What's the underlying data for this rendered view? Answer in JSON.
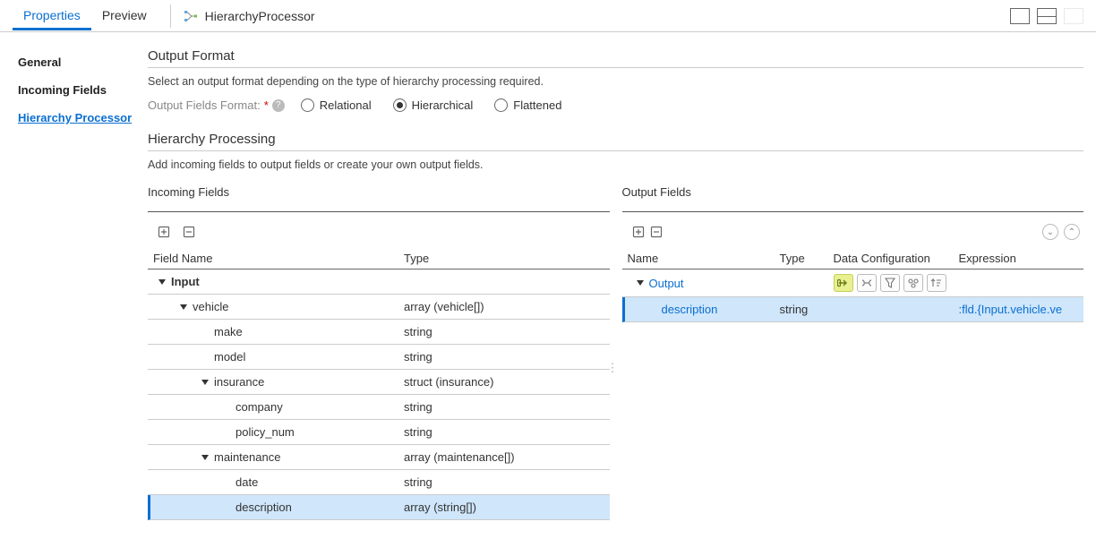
{
  "top": {
    "tabs": [
      "Properties",
      "Preview"
    ],
    "active_tab": 0,
    "processor_name": "HierarchyProcessor"
  },
  "sidebar": {
    "items": [
      "General",
      "Incoming Fields",
      "Hierarchy Processor"
    ],
    "active": 2
  },
  "output_format": {
    "title": "Output Format",
    "desc": "Select an output format depending on the type of hierarchy processing required.",
    "label": "Output Fields Format:",
    "options": [
      "Relational",
      "Hierarchical",
      "Flattened"
    ],
    "selected": 1
  },
  "hierarchy_processing": {
    "title": "Hierarchy Processing",
    "desc": "Add incoming fields to output fields or create your own output fields."
  },
  "incoming": {
    "title": "Incoming Fields",
    "columns": [
      "Field Name",
      "Type"
    ],
    "rows": [
      {
        "indent": 0,
        "caret": true,
        "bold": true,
        "name": "Input",
        "type": ""
      },
      {
        "indent": 1,
        "caret": true,
        "name": "vehicle",
        "type": "array (vehicle[])"
      },
      {
        "indent": 2,
        "caret": false,
        "name": "make",
        "type": "string"
      },
      {
        "indent": 2,
        "caret": false,
        "name": "model",
        "type": "string"
      },
      {
        "indent": 2,
        "caret": true,
        "name": "insurance",
        "type": "struct (insurance)"
      },
      {
        "indent": 3,
        "caret": false,
        "name": "company",
        "type": "string"
      },
      {
        "indent": 3,
        "caret": false,
        "name": "policy_num",
        "type": "string"
      },
      {
        "indent": 2,
        "caret": true,
        "name": "maintenance",
        "type": "array (maintenance[])"
      },
      {
        "indent": 3,
        "caret": false,
        "name": "date",
        "type": "string"
      },
      {
        "indent": 3,
        "caret": false,
        "name": "description",
        "type": "array (string[])",
        "selected": true
      }
    ]
  },
  "output": {
    "title": "Output Fields",
    "columns": [
      "Name",
      "Type",
      "Data Configuration",
      "Expression"
    ],
    "root": {
      "name": "Output"
    },
    "rows": [
      {
        "indent": 1,
        "name": "description",
        "type": "string",
        "expression": ":fld.{Input.vehicle.ve",
        "selected": true,
        "link": true
      }
    ]
  }
}
